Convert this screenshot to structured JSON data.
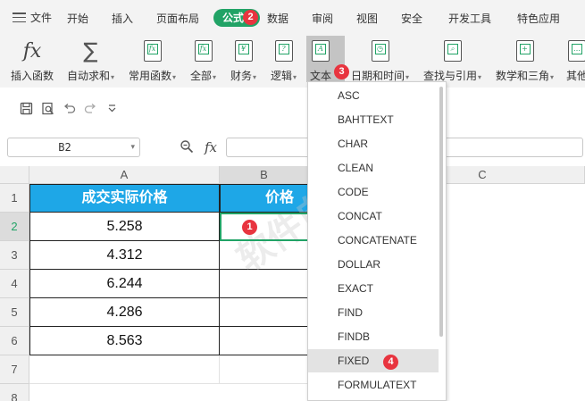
{
  "menubar": {
    "file_label": "文件",
    "tabs": [
      "开始",
      "插入",
      "页面布局",
      "数据",
      "审阅",
      "视图",
      "安全",
      "开发工具",
      "特色应用"
    ],
    "active_tab": "公式"
  },
  "ribbon": {
    "buttons": [
      "插入函数",
      "自动求和",
      "常用函数",
      "全部",
      "财务",
      "逻辑",
      "文本",
      "日期和时间",
      "查找与引用",
      "数学和三角",
      "其他"
    ],
    "fx_glyph": "fx",
    "sigma_glyph": "∑"
  },
  "formula_bar": {
    "name_box": "B2",
    "fx": "fx",
    "formula": ""
  },
  "sheet": {
    "columns": [
      "A",
      "B",
      "C"
    ],
    "rows": [
      "1",
      "2",
      "3",
      "4",
      "5",
      "6",
      "7",
      "8"
    ],
    "header_a": "成交实际价格",
    "header_b": "价格",
    "values": [
      "5.258",
      "4.312",
      "6.244",
      "4.286",
      "8.563"
    ]
  },
  "dropdown": {
    "items": [
      "ASC",
      "BAHTTEXT",
      "CHAR",
      "CLEAN",
      "CODE",
      "CONCAT",
      "CONCATENATE",
      "DOLLAR",
      "EXACT",
      "FIND",
      "FINDB",
      "FIXED",
      "FORMULATEXT"
    ],
    "highlighted": "FIXED"
  },
  "badges": [
    "1",
    "2",
    "3",
    "4"
  ],
  "watermark": "软件自学网",
  "colors": {
    "accent": "#21a366",
    "header_fill": "#1ea7e7",
    "badge": "#e8343f"
  }
}
